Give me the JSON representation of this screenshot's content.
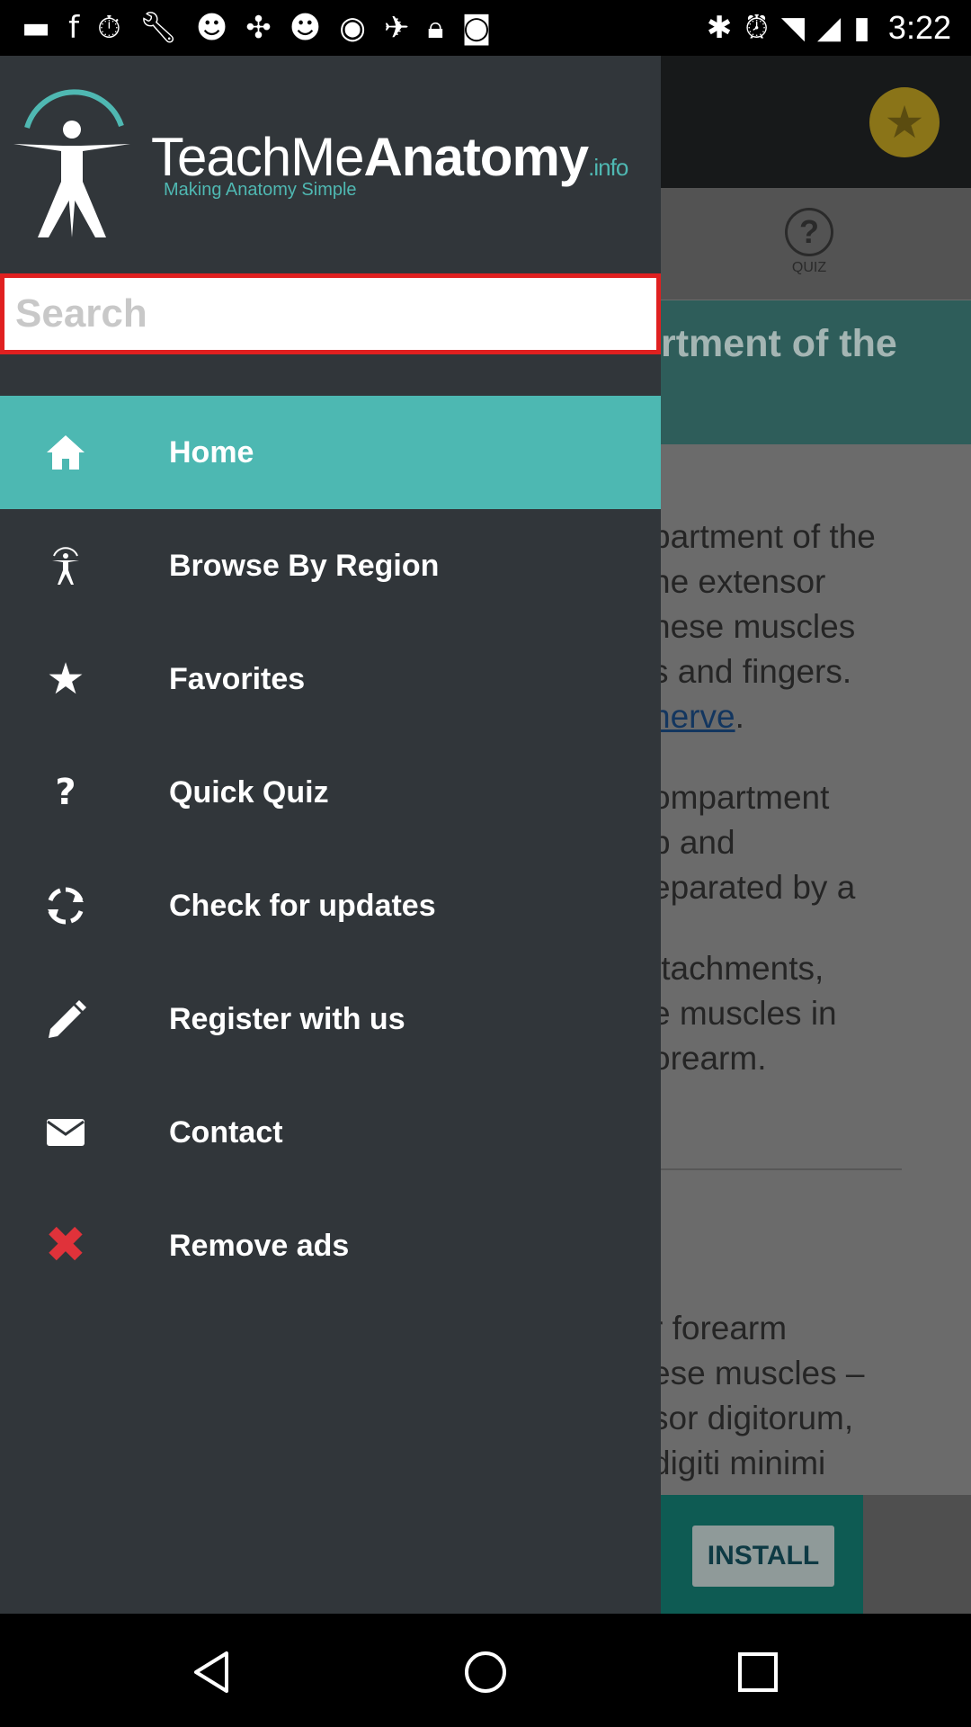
{
  "status_bar": {
    "time": "3:22",
    "left_icons": [
      "chat-icon",
      "facebook-icon",
      "timer-icon",
      "wrench-icon",
      "smiley-icon",
      "puzzle-icon",
      "smiley-icon",
      "media-icon",
      "fake-gps-icon",
      "lock-icon",
      "gamepad-icon"
    ],
    "right_icons": [
      "bluetooth-icon",
      "alarm-icon",
      "wifi-icon",
      "signal-icon",
      "battery-icon"
    ]
  },
  "app": {
    "quiz_label": "QUIZ",
    "banner_text": "rtment of the",
    "paragraphs": [
      {
        "lines": [
          "partment of the",
          "he extensor",
          "hese muscles",
          "s and fingers."
        ],
        "link": "nerve"
      },
      {
        "lines": [
          "ompartment",
          "p and",
          "eparated by a"
        ]
      },
      {
        "lines": [
          "ttachments,",
          "e muscles in",
          "orearm."
        ]
      }
    ],
    "paragraph2_lines": [
      "r forearm",
      "ese muscles –",
      "sor digitorum,",
      "digiti minimi"
    ],
    "install_label": "INSTALL"
  },
  "drawer": {
    "logo": {
      "name_light": "TeachMe",
      "name_bold": "Anatomy",
      "name_suffix": ".info",
      "tagline": "Making Anatomy Simple"
    },
    "search": {
      "placeholder": "Search",
      "value": ""
    },
    "items": [
      {
        "label": "Home",
        "icon": "home-icon",
        "active": true
      },
      {
        "label": "Browse By Region",
        "icon": "body-figure-icon",
        "active": false
      },
      {
        "label": "Favorites",
        "icon": "star-icon",
        "active": false
      },
      {
        "label": "Quick Quiz",
        "icon": "question-icon",
        "active": false
      },
      {
        "label": "Check for updates",
        "icon": "refresh-icon",
        "active": false
      },
      {
        "label": "Register with us",
        "icon": "pencil-icon",
        "active": false
      },
      {
        "label": "Contact",
        "icon": "envelope-icon",
        "active": false
      },
      {
        "label": "Remove ads",
        "icon": "close-icon",
        "active": false
      }
    ]
  },
  "colors": {
    "accent": "#4db8b2",
    "drawer_bg": "#31363a",
    "search_border": "#e02020",
    "remove_ads_icon": "#e0323a"
  }
}
